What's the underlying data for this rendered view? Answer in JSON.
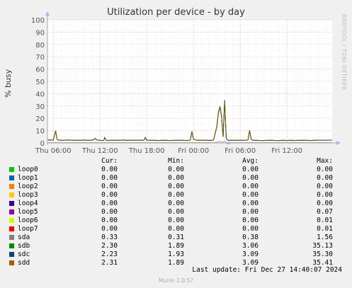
{
  "chart_data": {
    "type": "line",
    "title": "Utilization per device - by day",
    "ylabel": "% busy",
    "ylim": [
      0,
      100
    ],
    "yticks": [
      0,
      10,
      20,
      30,
      40,
      50,
      60,
      70,
      80,
      90,
      100
    ],
    "xlim": [
      5.25,
      16.75
    ],
    "xticks": [
      {
        "x": 6,
        "label": "Thu 06:00"
      },
      {
        "x": 12,
        "label": "Thu 12:00"
      },
      {
        "x": 18,
        "label": "Thu 18:00"
      },
      {
        "x": 24,
        "label": "Fri 00:00"
      },
      {
        "x": 30,
        "label": "Fri 06:00"
      },
      {
        "x": 36,
        "label": "Fri 12:00"
      }
    ],
    "series_hours": [
      5.2,
      5.5,
      6.0,
      6.3,
      6.5,
      6.6,
      6.7,
      7.0,
      7.5,
      8.0,
      8.5,
      9.0,
      9.5,
      10.0,
      10.5,
      11.0,
      11.2,
      11.4,
      11.6,
      11.9,
      12.2,
      12.5,
      12.6,
      12.8,
      13.0,
      13.5,
      14.0,
      14.5,
      15.0,
      15.5,
      16.0,
      16.5,
      17.0,
      17.5,
      17.7,
      17.8,
      18.0,
      18.5,
      19.0,
      19.5,
      20.0,
      20.5,
      21.0,
      21.5,
      22.0,
      22.5,
      23.0,
      23.5,
      23.6,
      23.8,
      24.0,
      24.5,
      25.0,
      25.5,
      26.0,
      26.5,
      26.6,
      27.0,
      27.2,
      27.4,
      27.6,
      27.8,
      28.0,
      28.2,
      28.3,
      28.4,
      28.6,
      28.8,
      29.0,
      29.5,
      30.0,
      30.5,
      31.0,
      31.2,
      31.4,
      31.6,
      32.0,
      32.5,
      33.0,
      33.5,
      34.0,
      34.5,
      35.0,
      35.5,
      36.0,
      36.5,
      37.0,
      37.5,
      38.0,
      38.5,
      39.0,
      39.5,
      40.0,
      40.5,
      41.0,
      41.5,
      41.8
    ],
    "series": [
      {
        "name": "sdb",
        "color": "#00cc00",
        "values": [
          2.5,
          2.5,
          2.3,
          10,
          3,
          2.5,
          2.3,
          2.2,
          2.3,
          2.5,
          2.2,
          2.3,
          2.1,
          2.4,
          2.2,
          2.3,
          2.8,
          3.8,
          2.4,
          2.2,
          2.0,
          2.2,
          4.5,
          2.2,
          2.0,
          2.3,
          2.1,
          2.2,
          2.4,
          2.1,
          2.3,
          2.2,
          2.3,
          2.1,
          2.8,
          4.5,
          2.3,
          2.2,
          2.1,
          2.0,
          2.2,
          2.1,
          2.0,
          2.2,
          2.1,
          2.2,
          2.0,
          2.1,
          2.5,
          9.5,
          3.0,
          2.2,
          2.3,
          2.2,
          2.1,
          2.1,
          3.0,
          14,
          25,
          30,
          22,
          5,
          35,
          4,
          3,
          2.3,
          2.2,
          2.2,
          2.1,
          2.1,
          2.3,
          2.2,
          2.5,
          10.5,
          3.0,
          2.2,
          2.1,
          2.0,
          2.0,
          2.1,
          2.2,
          2.0,
          2.0,
          2.1,
          2.0,
          2.1,
          2.0,
          2.1,
          2.2,
          2.1,
          2.0,
          2.2,
          2.3,
          2.3,
          2.3,
          2.3,
          2.3
        ]
      },
      {
        "name": "sdc",
        "color": "#0066b3",
        "values": [
          2.3,
          2.4,
          2.2,
          9.5,
          2.9,
          2.4,
          2.2,
          2.1,
          2.2,
          2.3,
          2.1,
          2.2,
          2.0,
          2.3,
          2.1,
          2.2,
          2.6,
          3.6,
          2.3,
          2.1,
          1.9,
          2.1,
          4.2,
          2.1,
          1.9,
          2.2,
          2.0,
          2.1,
          2.3,
          2.0,
          2.2,
          2.1,
          2.2,
          2.0,
          2.6,
          4.3,
          2.2,
          2.1,
          2.0,
          1.9,
          2.1,
          2.0,
          1.9,
          2.1,
          2.0,
          2.1,
          1.9,
          2.0,
          2.4,
          9.0,
          2.9,
          2.1,
          2.2,
          2.1,
          2.0,
          2.0,
          2.9,
          13,
          24,
          29,
          21,
          4.8,
          34,
          3.8,
          2.9,
          2.2,
          2.1,
          2.1,
          2.0,
          2.0,
          2.2,
          2.1,
          2.4,
          10,
          2.9,
          2.1,
          2.0,
          1.9,
          1.9,
          2.0,
          2.1,
          1.9,
          1.9,
          2.0,
          1.9,
          2.0,
          1.9,
          2.0,
          2.1,
          2.0,
          1.9,
          2.1,
          2.2,
          2.2,
          2.2,
          2.2,
          2.2
        ]
      },
      {
        "name": "sdd",
        "color": "#b35a00",
        "values": [
          2.4,
          2.5,
          2.3,
          9.8,
          3.0,
          2.5,
          2.3,
          2.2,
          2.3,
          2.4,
          2.2,
          2.3,
          2.1,
          2.4,
          2.2,
          2.3,
          2.7,
          3.7,
          2.4,
          2.2,
          2.0,
          2.2,
          4.4,
          2.2,
          2.0,
          2.3,
          2.1,
          2.2,
          2.4,
          2.1,
          2.3,
          2.2,
          2.3,
          2.1,
          2.7,
          4.4,
          2.3,
          2.2,
          2.1,
          2.0,
          2.2,
          2.1,
          2.0,
          2.2,
          2.1,
          2.2,
          2.0,
          2.1,
          2.5,
          9.3,
          3.0,
          2.2,
          2.3,
          2.2,
          2.1,
          2.1,
          3.0,
          13.5,
          25,
          29.5,
          21.5,
          4.9,
          34.5,
          3.9,
          3.0,
          2.3,
          2.2,
          2.2,
          2.1,
          2.1,
          2.3,
          2.2,
          2.5,
          10.2,
          3.0,
          2.2,
          2.1,
          2.0,
          2.0,
          2.1,
          2.2,
          2.0,
          2.0,
          2.1,
          2.0,
          2.1,
          2.0,
          2.1,
          2.2,
          2.1,
          2.0,
          2.2,
          2.3,
          2.3,
          2.3,
          2.3,
          2.3
        ]
      },
      {
        "name": "sda",
        "color": "#999999",
        "values": [
          0.3,
          0.3,
          0.3,
          0.4,
          0.3,
          0.3,
          0.3,
          0.3,
          0.3,
          0.3,
          0.3,
          0.3,
          0.3,
          0.3,
          0.3,
          0.3,
          0.3,
          0.4,
          0.3,
          0.3,
          0.3,
          0.3,
          0.4,
          0.3,
          0.3,
          0.3,
          0.3,
          0.3,
          0.3,
          0.3,
          0.3,
          0.3,
          0.3,
          0.3,
          0.3,
          0.4,
          0.3,
          0.3,
          0.3,
          0.3,
          0.3,
          0.3,
          0.3,
          0.3,
          0.3,
          0.3,
          0.3,
          0.3,
          0.3,
          0.4,
          0.3,
          0.3,
          0.3,
          0.3,
          0.3,
          0.3,
          0.3,
          0.5,
          0.8,
          1.2,
          0.8,
          0.4,
          1.5,
          0.4,
          0.3,
          0.3,
          0.3,
          0.3,
          0.3,
          0.3,
          0.3,
          0.3,
          0.3,
          0.5,
          0.3,
          0.3,
          0.3,
          0.3,
          0.3,
          0.3,
          0.3,
          0.3,
          0.3,
          0.3,
          0.3,
          0.3,
          0.3,
          0.3,
          0.3,
          0.3,
          0.3,
          0.3,
          0.3,
          0.3,
          0.3,
          0.3,
          0.3
        ]
      }
    ],
    "grid": true,
    "legend_position": "bottom"
  },
  "rrd_credit": "RRDTOOL / TOBI OETIKER",
  "legend": {
    "headers": {
      "cur": "Cur:",
      "min": "Min:",
      "avg": "Avg:",
      "max": "Max:"
    },
    "rows": [
      {
        "name": "loop0",
        "color": "#00cc00",
        "cur": "0.00",
        "min": "0.00",
        "avg": "0.00",
        "max": "0.00"
      },
      {
        "name": "loop1",
        "color": "#0066b3",
        "cur": "0.00",
        "min": "0.00",
        "avg": "0.00",
        "max": "0.00"
      },
      {
        "name": "loop2",
        "color": "#ff8000",
        "cur": "0.00",
        "min": "0.00",
        "avg": "0.00",
        "max": "0.00"
      },
      {
        "name": "loop3",
        "color": "#ffcc00",
        "cur": "0.00",
        "min": "0.00",
        "avg": "0.00",
        "max": "0.00"
      },
      {
        "name": "loop4",
        "color": "#330099",
        "cur": "0.00",
        "min": "0.00",
        "avg": "0.00",
        "max": "0.00"
      },
      {
        "name": "loop5",
        "color": "#990099",
        "cur": "0.00",
        "min": "0.00",
        "avg": "0.00",
        "max": "0.07"
      },
      {
        "name": "loop6",
        "color": "#ccff00",
        "cur": "0.00",
        "min": "0.00",
        "avg": "0.00",
        "max": "0.01"
      },
      {
        "name": "loop7",
        "color": "#ff0000",
        "cur": "0.00",
        "min": "0.00",
        "avg": "0.00",
        "max": "0.01"
      },
      {
        "name": "sda",
        "color": "#808080",
        "cur": "0.33",
        "min": "0.31",
        "avg": "0.38",
        "max": "1.56"
      },
      {
        "name": "sdb",
        "color": "#008f00",
        "cur": "2.30",
        "min": "1.89",
        "avg": "3.06",
        "max": "35.13"
      },
      {
        "name": "sdc",
        "color": "#00487d",
        "cur": "2.23",
        "min": "1.93",
        "avg": "3.09",
        "max": "35.30"
      },
      {
        "name": "sdd",
        "color": "#b35a00",
        "cur": "2.31",
        "min": "1.89",
        "avg": "3.09",
        "max": "35.41"
      }
    ]
  },
  "footer": "Last update: Fri Dec 27 14:40:07 2024",
  "version": "Munin 2.0.57"
}
